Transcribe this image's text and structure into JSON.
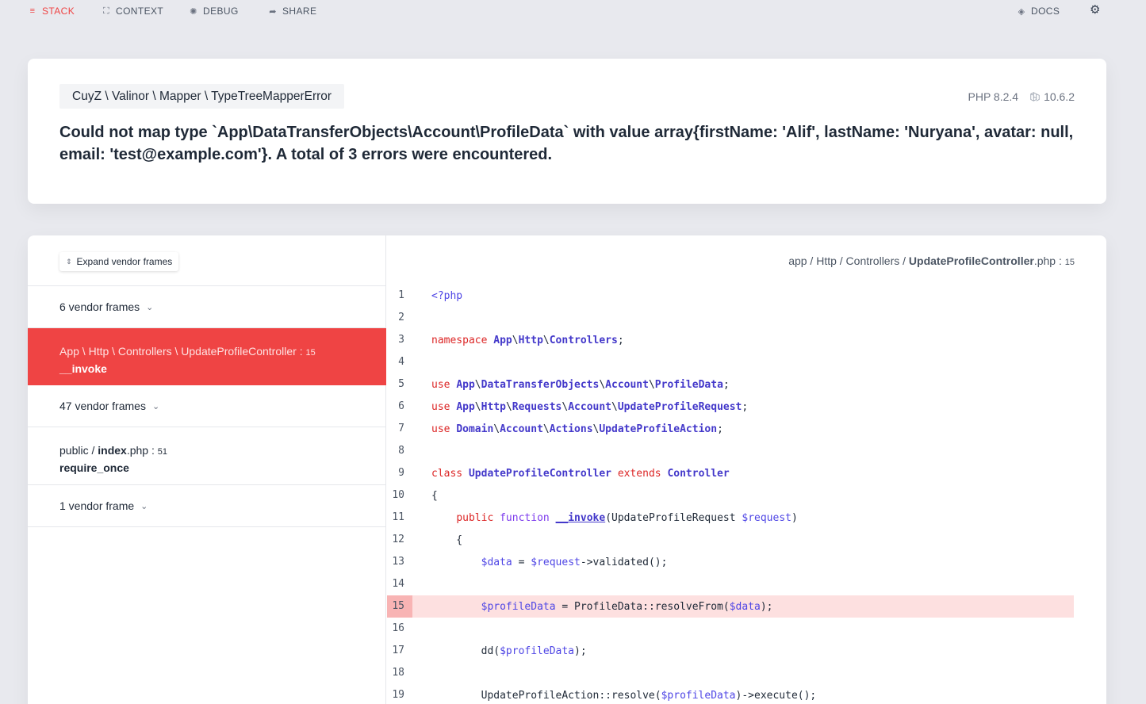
{
  "nav": {
    "stack": "STACK",
    "context": "CONTEXT",
    "debug": "DEBUG",
    "share": "SHARE",
    "docs": "DOCS"
  },
  "exception": {
    "class": "CuyZ \\ Valinor \\ Mapper \\ TypeTreeMapperError",
    "php_version": "PHP 8.2.4",
    "laravel_version": "10.6.2",
    "message": "Could not map type `App\\DataTransferObjects\\Account\\ProfileData` with value array{firstName: 'Alif', lastName: 'Nuryana', avatar: null, email: 'test@example.com'}. A total of 3 errors were encountered."
  },
  "frames": {
    "expand_label": "Expand vendor frames",
    "vendor_group_1": "6 vendor frames",
    "selected": {
      "location": "App \\ Http \\ Controllers \\ UpdateProfileController : ",
      "line": "15",
      "method": "__invoke"
    },
    "vendor_group_2": "47 vendor frames",
    "index": {
      "prefix": "public / ",
      "file": "index",
      "ext": ".php : ",
      "line": "51",
      "method": "require_once"
    },
    "vendor_group_3": "1 vendor frame"
  },
  "code": {
    "path_prefix": "app / Http / Controllers / ",
    "file": "UpdateProfileController",
    "ext": ".php : ",
    "line": "15",
    "highlighted_line": 15,
    "line_numbers": [
      "1",
      "2",
      "3",
      "4",
      "5",
      "6",
      "7",
      "8",
      "9",
      "10",
      "11",
      "12",
      "13",
      "14",
      "15",
      "16",
      "17",
      "18",
      "19"
    ]
  },
  "colors": {
    "accent": "#ef4444",
    "highlight_bg": "#fde0e0",
    "background": "#e8e9ee"
  }
}
